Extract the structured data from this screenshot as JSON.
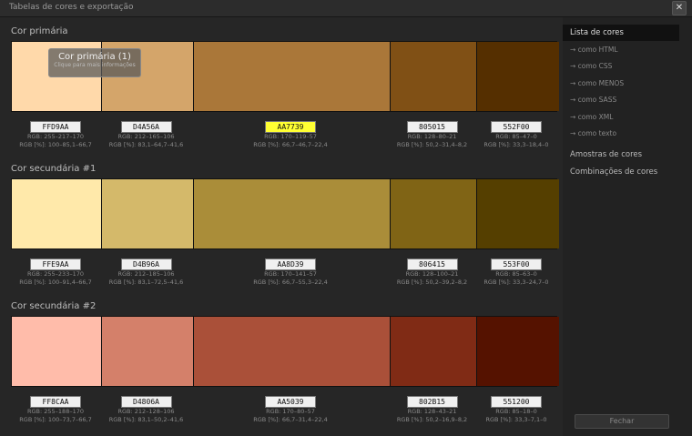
{
  "window": {
    "title": "Tabelas de cores e exportação",
    "close_symbol": "✕"
  },
  "tooltip": {
    "title": "Cor primária (1)",
    "subtitle": "Clique para mais informações"
  },
  "sections": [
    {
      "title": "Cor primária",
      "swatches": [
        {
          "color": "#FFD9AA",
          "hex": "FFD9AA",
          "rgb": "RGB: 255–217–170",
          "rgbpct": "RGB [%]: 100–85,1–66,7"
        },
        {
          "color": "#D4A56A",
          "hex": "D4A56A",
          "rgb": "RGB: 212–165–106",
          "rgbpct": "RGB [%]: 83,1–64,7–41,6"
        },
        {
          "color": "#AA7739",
          "hex": "AA7739",
          "rgb": "RGB: 170–119–57",
          "rgbpct": "RGB [%]: 66,7–46,7–22,4"
        },
        {
          "color": "#805015",
          "hex": "805015",
          "rgb": "RGB: 128–80–21",
          "rgbpct": "RGB [%]: 50,2–31,4–8,2"
        },
        {
          "color": "#552F00",
          "hex": "552F00",
          "rgb": "RGB: 85–47–0",
          "rgbpct": "RGB [%]: 33,3–18,4–0"
        }
      ]
    },
    {
      "title": "Cor secundária #1",
      "swatches": [
        {
          "color": "#FFE9AA",
          "hex": "FFE9AA",
          "rgb": "RGB: 255–233–170",
          "rgbpct": "RGB [%]: 100–91,4–66,7"
        },
        {
          "color": "#D4B96A",
          "hex": "D4B96A",
          "rgb": "RGB: 212–185–106",
          "rgbpct": "RGB [%]: 83,1–72,5–41,6"
        },
        {
          "color": "#AA8D39",
          "hex": "AA8D39",
          "rgb": "RGB: 170–141–57",
          "rgbpct": "RGB [%]: 66,7–55,3–22,4"
        },
        {
          "color": "#806415",
          "hex": "806415",
          "rgb": "RGB: 128–100–21",
          "rgbpct": "RGB [%]: 50,2–39,2–8,2"
        },
        {
          "color": "#553F00",
          "hex": "553F00",
          "rgb": "RGB: 85–63–0",
          "rgbpct": "RGB [%]: 33,3–24,7–0"
        }
      ]
    },
    {
      "title": "Cor secundária #2",
      "swatches": [
        {
          "color": "#FFBCAA",
          "hex": "FF8CAA",
          "rgb": "RGB: 255–188–170",
          "rgbpct": "RGB [%]: 100–73,7–66,7"
        },
        {
          "color": "#D4806A",
          "hex": "D4806A",
          "rgb": "RGB: 212–128–106",
          "rgbpct": "RGB [%]: 83,1–50,2–41,6"
        },
        {
          "color": "#AA5039",
          "hex": "AA5039",
          "rgb": "RGB: 170–80–57",
          "rgbpct": "RGB [%]: 66,7–31,4–22,4"
        },
        {
          "color": "#802B15",
          "hex": "802B15",
          "rgb": "RGB: 128–43–21",
          "rgbpct": "RGB [%]: 50,2–16,9–8,2"
        },
        {
          "color": "#551200",
          "hex": "551200",
          "rgb": "RGB: 85–18–0",
          "rgbpct": "RGB [%]: 33,3–7,1–0"
        }
      ]
    }
  ],
  "sidebar": {
    "items": [
      {
        "label": "Lista de cores",
        "style": "active"
      },
      {
        "label": "→ como HTML",
        "style": "sub"
      },
      {
        "label": "→ como CSS",
        "style": "sub"
      },
      {
        "label": "→ como MENOS",
        "style": "sub"
      },
      {
        "label": "→ como SASS",
        "style": "sub"
      },
      {
        "label": "→ como XML",
        "style": "sub"
      },
      {
        "label": "→ como texto",
        "style": "sub"
      },
      {
        "label": "Amostras de cores",
        "style": "bold"
      },
      {
        "label": "Combinações de cores",
        "style": "bold"
      }
    ],
    "close_button": "Fechar"
  }
}
